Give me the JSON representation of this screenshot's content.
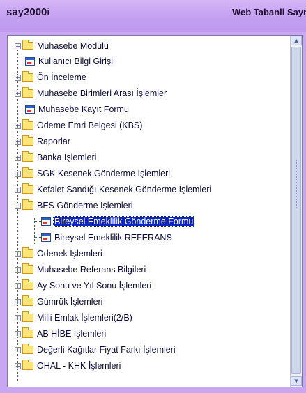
{
  "header": {
    "app_title": "say2000i",
    "right_title": "Web Tabanli Sayn"
  },
  "colors": {
    "header_bg": "#c9a6f2",
    "selected_bg": "#0a24c8",
    "folder": "#fde57a"
  },
  "tree": {
    "root": {
      "label": "Muhasebe Modülü",
      "icon": "folder-open-icon",
      "expanded": true
    },
    "items": [
      {
        "label": "Kullanıcı Bilgi Girişi",
        "icon": "form-icon"
      },
      {
        "label": "Ön İnceleme",
        "icon": "folder-icon",
        "expander": "plus"
      },
      {
        "label": "Muhasebe Birimleri Arası İşlemler",
        "icon": "folder-icon",
        "expander": "plus"
      },
      {
        "label": "Muhasebe Kayıt Formu",
        "icon": "form-icon"
      },
      {
        "label": "Ödeme Emri Belgesi (KBS)",
        "icon": "folder-icon",
        "expander": "plus"
      },
      {
        "label": "Raporlar",
        "icon": "folder-icon",
        "expander": "plus"
      },
      {
        "label": "Banka İşlemleri",
        "icon": "folder-icon",
        "expander": "plus"
      },
      {
        "label": "SGK Kesenek Gönderme İşlemleri",
        "icon": "folder-icon",
        "expander": "plus"
      },
      {
        "label": "Kefalet Sandığı Kesenek Gönderme İşlemleri",
        "icon": "folder-icon",
        "expander": "plus"
      },
      {
        "label": "BES Gönderme İşlemleri",
        "icon": "folder-open-icon",
        "expander": "minus",
        "children": [
          {
            "label": "Bireysel Emeklilik Gönderme Formu",
            "icon": "form-icon",
            "selected": true
          },
          {
            "label": "Bireysel Emeklilik  REFERANS",
            "icon": "form-icon"
          }
        ]
      },
      {
        "label": "Ödenek İşlemleri",
        "icon": "folder-icon",
        "expander": "plus"
      },
      {
        "label": "Muhasebe Referans Bilgileri",
        "icon": "folder-icon",
        "expander": "plus"
      },
      {
        "label": "Ay Sonu ve Yıl Sonu İşlemleri",
        "icon": "folder-icon",
        "expander": "plus"
      },
      {
        "label": "Gümrük İşlemleri",
        "icon": "folder-icon",
        "expander": "plus"
      },
      {
        "label": "Milli Emlak İşlemleri(2/B)",
        "icon": "folder-icon",
        "expander": "plus"
      },
      {
        "label": "AB HİBE İşlemleri",
        "icon": "folder-icon",
        "expander": "plus"
      },
      {
        "label": "Değerli  Kağıtlar Fiyat  Farkı İşlemleri",
        "icon": "folder-icon",
        "expander": "plus"
      },
      {
        "label": "OHAL - KHK İşlemleri",
        "icon": "folder-icon",
        "expander": "plus"
      }
    ]
  }
}
